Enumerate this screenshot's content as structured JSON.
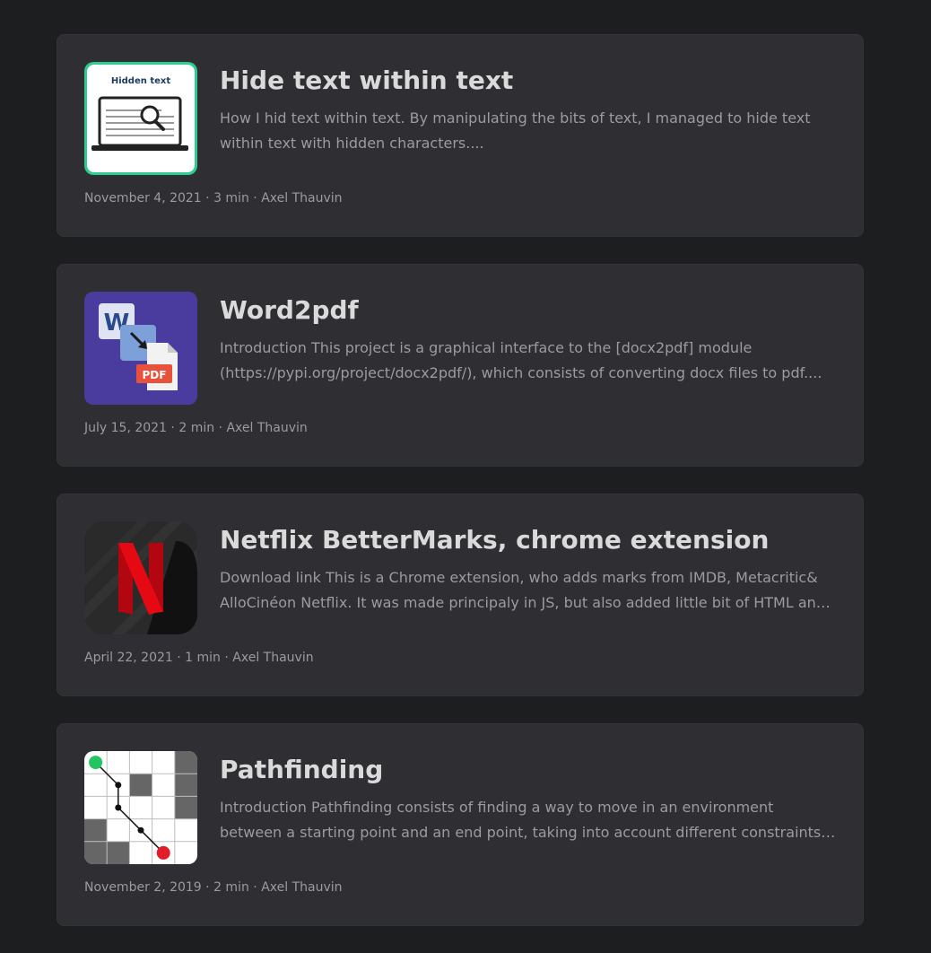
{
  "posts": [
    {
      "title": "Hide text within text",
      "summary": "How I hid text within text. By manipulating the bits of text, I managed to hide text within text with hidden characters....",
      "date": "November 4, 2021",
      "read_time": "3 min",
      "author": "Axel Thauvin",
      "thumbnail_label": "Hidden text",
      "thumbnail_icon": "hidden-text-laptop-icon"
    },
    {
      "title": "Word2pdf",
      "summary": "Introduction This project is a graphical interface to the [docx2pdf] module (https://pypi.org/project/docx2pdf/), which consists of converting docx files to pdf....",
      "date": "July 15, 2021",
      "read_time": "2 min",
      "author": "Axel Thauvin",
      "thumbnail_label": "PDF",
      "thumbnail_letter": "W",
      "thumbnail_icon": "word-to-pdf-icon"
    },
    {
      "title": "Netflix BetterMarks, chrome extension",
      "summary": "Download link This is a Chrome extension, who adds marks from IMDB, Metacritic& AlloCinéon Netflix. It was made principaly in JS, but also added little bit of HTML and CSS....",
      "date": "April 22, 2021",
      "read_time": "1 min",
      "author": "Axel Thauvin",
      "thumbnail_icon": "netflix-logo-icon"
    },
    {
      "title": "Pathfinding",
      "summary": "Introduction Pathfinding consists of finding a way to move in an environment between a starting point and an end point, taking into account different constraints Description The....",
      "date": "November 2, 2019",
      "read_time": "2 min",
      "author": "Axel Thauvin",
      "thumbnail_icon": "pathfinding-grid-icon"
    }
  ],
  "meta_separator": " · ",
  "colors": {
    "page_bg": "#1d1e20",
    "card_bg": "#2e2e33",
    "title": "#dadadb",
    "secondary_text": "#9b9c9d",
    "hidden_text_border": "#2ecc8f",
    "word_bg": "#4a3c9e",
    "pdf_red": "#e8513c",
    "netflix_red": "#e50914",
    "path_start": "#22c55e",
    "path_end": "#e11d2a"
  }
}
